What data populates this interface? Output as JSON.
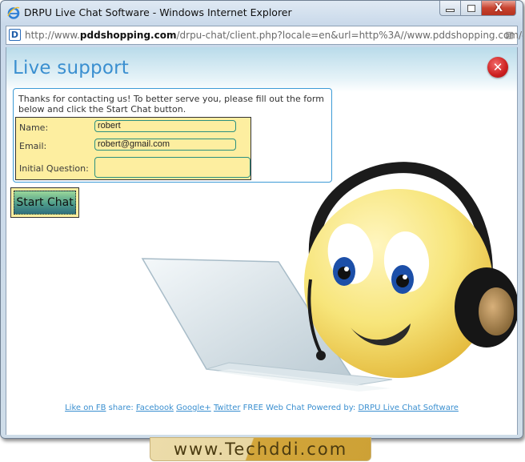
{
  "window": {
    "title": "DRPU Live Chat Software - Windows Internet Explorer",
    "controls": {
      "minimize": "minimize",
      "maximize": "maximize",
      "close": "close"
    }
  },
  "addressbar": {
    "url_prefix": "http://www.",
    "url_domain": "pddshopping.com",
    "url_rest": "/drpu-chat/client.php?locale=en&url=http%3A//www.pddshopping.com/&referr",
    "site_icon_letter": "D"
  },
  "page": {
    "title": "Live support",
    "close_glyph": "✕",
    "intro": "Thanks for contacting us! To better serve you, please fill out the form below and click the Start Chat button.",
    "form": {
      "name_label": "Name:",
      "name_value": "robert",
      "email_label": "Email:",
      "email_value": "robert@gmail.com",
      "question_label": "Initial Question:",
      "question_value": ""
    },
    "start_button": "Start Chat",
    "footer": {
      "like_fb": "Like on FB",
      "share_label": " share: ",
      "facebook": "Facebook",
      "googleplus": "Google+",
      "twitter": "Twitter",
      "powered_text": " FREE Web Chat Powered by: ",
      "drpu_link": "DRPU Live Chat Software"
    }
  },
  "watermark": "www.Techddi.com",
  "colors": {
    "accent_blue": "#3a8fd0",
    "form_yellow": "#fdeea0",
    "input_border": "#2b9080",
    "close_red": "#cc1f1f"
  }
}
